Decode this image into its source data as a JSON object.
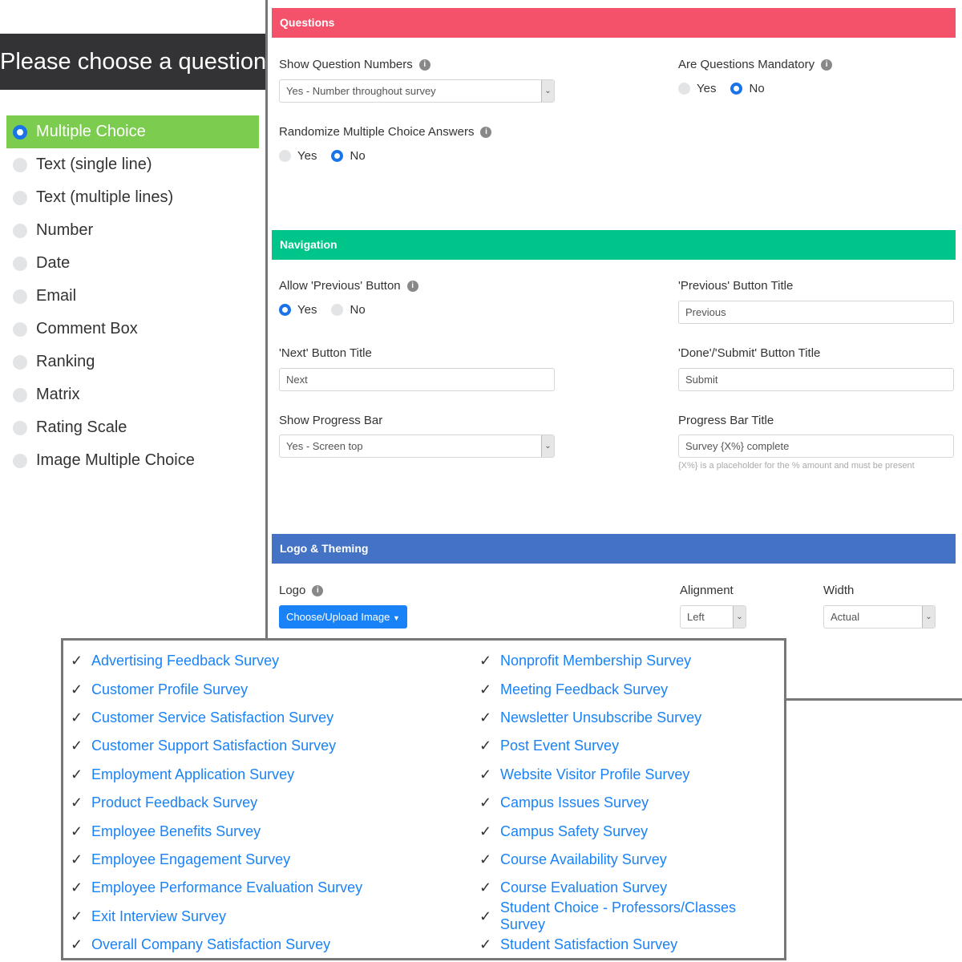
{
  "left": {
    "title": "Please choose a question type",
    "items": [
      {
        "label": "Multiple Choice",
        "selected": true
      },
      {
        "label": "Text (single line)"
      },
      {
        "label": "Text (multiple lines)"
      },
      {
        "label": "Number"
      },
      {
        "label": "Date"
      },
      {
        "label": "Email"
      },
      {
        "label": "Comment Box"
      },
      {
        "label": "Ranking"
      },
      {
        "label": "Matrix"
      },
      {
        "label": "Rating Scale"
      },
      {
        "label": "Image Multiple Choice"
      }
    ]
  },
  "questions": {
    "title": "Questions",
    "color": "#f4526b",
    "show_numbers": {
      "label": "Show Question Numbers",
      "value": "Yes - Number throughout survey"
    },
    "mandatory": {
      "label": "Are Questions Mandatory",
      "yes": "Yes",
      "no": "No",
      "selected": "No"
    },
    "randomize": {
      "label": "Randomize Multiple Choice Answers",
      "yes": "Yes",
      "no": "No",
      "selected": "No"
    }
  },
  "navigation": {
    "title": "Navigation",
    "color": "#00c58a",
    "allow_prev": {
      "label": "Allow 'Previous' Button",
      "yes": "Yes",
      "no": "No",
      "selected": "Yes"
    },
    "prev_title": {
      "label": "'Previous' Button Title",
      "value": "Previous"
    },
    "next_title": {
      "label": "'Next' Button Title",
      "value": "Next"
    },
    "done_title": {
      "label": "'Done'/'Submit' Button Title",
      "value": "Submit"
    },
    "progress": {
      "label": "Show Progress Bar",
      "value": "Yes - Screen top"
    },
    "progress_title": {
      "label": "Progress Bar Title",
      "value": "Survey {X%} complete",
      "hint": "{X%} is a placeholder for the % amount and must be present"
    }
  },
  "logo": {
    "title": "Logo & Theming",
    "color": "#4472c4",
    "label": "Logo",
    "button": "Choose/Upload Image",
    "alignment": {
      "label": "Alignment",
      "value": "Left"
    },
    "width": {
      "label": "Width",
      "value": "Actual"
    }
  },
  "templates": {
    "check": "✓",
    "col1": [
      "Advertising Feedback Survey",
      "Customer Profile Survey",
      "Customer Service Satisfaction Survey",
      "Customer Support Satisfaction Survey",
      "Employment Application Survey",
      "Product Feedback Survey",
      "Employee Benefits Survey",
      "Employee Engagement Survey",
      "Employee Performance Evaluation Survey",
      "Exit Interview Survey",
      "Overall Company Satisfaction Survey"
    ],
    "col2": [
      "Nonprofit Membership Survey",
      "Meeting Feedback Survey",
      "Newsletter Unsubscribe Survey",
      "Post Event Survey",
      "Website Visitor Profile Survey",
      "Campus Issues Survey",
      "Campus Safety Survey",
      "Course Availability Survey",
      "Course Evaluation Survey",
      "Student Choice - Professors/Classes Survey",
      "Student Satisfaction Survey"
    ]
  }
}
